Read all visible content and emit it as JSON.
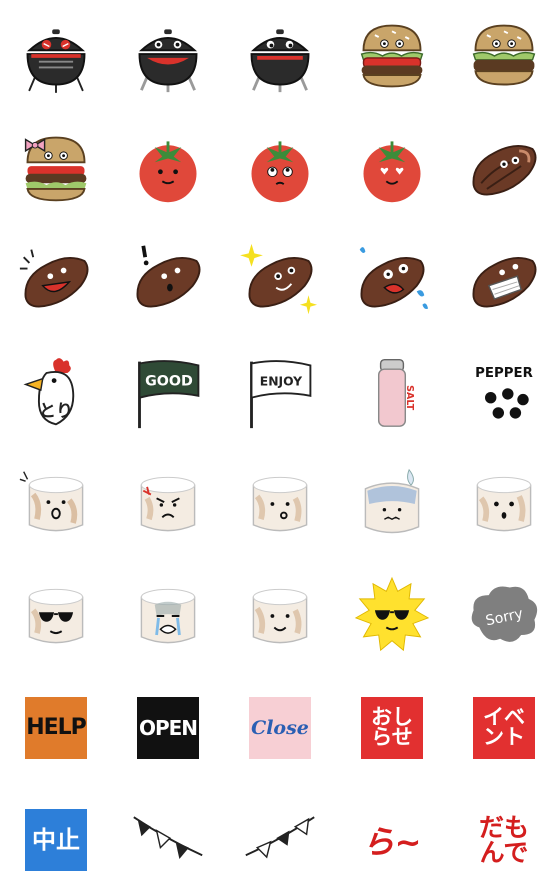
{
  "sheet_title": "",
  "colors": {
    "grill_body": "#2b2b2b",
    "grill_mouth": "#d9322b",
    "bun": "#c9a56a",
    "patty": "#5a3a22",
    "lettuce": "#9fc96a",
    "tomato": "#e0483a",
    "tomato_leaf": "#3c8c3a",
    "steak": "#6b3a26",
    "steak_fat": "#c98b6b",
    "flag_green": "#2f4a36",
    "salt_pink": "#f2c8cf",
    "pepper_black": "#111111",
    "marshmallow": "#f4ece2",
    "marshmallow_toast": "#c9a27a",
    "sun": "#ffe12e",
    "sorry_cloud": "#7f7f7f",
    "help_bg": "#e07b2b",
    "open_bg": "#111111",
    "close_bg": "#f7cfd4",
    "close_text": "#2a5fb3",
    "red_bg": "#e23030",
    "blue_bg": "#2d7fd9"
  },
  "stickers": {
    "good_flag": {
      "text": "GOOD"
    },
    "enjoy_flag": {
      "text": "ENJOY"
    },
    "salt": {
      "text": "SALT"
    },
    "pepper": {
      "text": "PEPPER"
    },
    "tori": {
      "text": "とり"
    },
    "sorry": {
      "text": "Sorry"
    },
    "help": {
      "text": "HELP"
    },
    "open": {
      "text": "OPEN"
    },
    "close": {
      "text": "Close"
    },
    "oshirase": {
      "line1": "おし",
      "line2": "らせ"
    },
    "event": {
      "line1": "イベ",
      "line2": "ント"
    },
    "chushi": {
      "text": "中止"
    },
    "su": {
      "text": "ら~"
    },
    "damonde": {
      "line1": "だも",
      "line2": "んで"
    }
  }
}
